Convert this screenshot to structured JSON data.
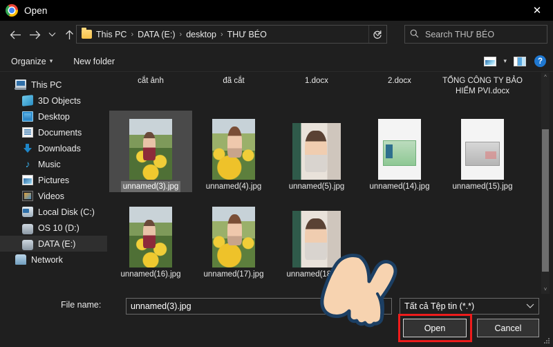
{
  "window": {
    "title": "Open",
    "app_icon": "chrome-logo-icon",
    "close_label": "✕"
  },
  "nav": {
    "back_icon": "arrow-left-icon",
    "forward_icon": "arrow-right-icon",
    "recent_icon": "chevron-down-icon",
    "up_icon": "arrow-up-icon"
  },
  "address": {
    "folder_icon": "folder-icon",
    "crumbs": [
      "This PC",
      "DATA (E:)",
      "desktop",
      "THƯ BÉO"
    ],
    "separator": "›",
    "dropdown_icon": "chevron-down-icon",
    "refresh_icon": "refresh-icon"
  },
  "search": {
    "icon": "search-icon",
    "placeholder": "Search THƯ BÉO",
    "value": ""
  },
  "command_bar": {
    "organize_label": "Organize",
    "organize_caret": "▾",
    "new_folder_label": "New folder",
    "view_icon": "view-options-icon",
    "view_caret": "▾",
    "pane_icon": "preview-pane-icon",
    "help_icon": "help-icon",
    "help_label": "?"
  },
  "sidebar": {
    "items": [
      {
        "label": "This PC",
        "icon": "this-pc-icon",
        "indent": 0,
        "selected": false
      },
      {
        "label": "3D Objects",
        "icon": "3d-objects-icon",
        "indent": 1,
        "selected": false
      },
      {
        "label": "Desktop",
        "icon": "desktop-icon",
        "indent": 1,
        "selected": false
      },
      {
        "label": "Documents",
        "icon": "documents-icon",
        "indent": 1,
        "selected": false
      },
      {
        "label": "Downloads",
        "icon": "downloads-icon",
        "indent": 1,
        "selected": false
      },
      {
        "label": "Music",
        "icon": "music-icon",
        "indent": 1,
        "selected": false
      },
      {
        "label": "Pictures",
        "icon": "pictures-icon",
        "indent": 1,
        "selected": false
      },
      {
        "label": "Videos",
        "icon": "videos-icon",
        "indent": 1,
        "selected": false
      },
      {
        "label": "Local Disk (C:)",
        "icon": "local-disk-icon",
        "indent": 1,
        "selected": false
      },
      {
        "label": "OS 10 (D:)",
        "icon": "drive-icon",
        "indent": 1,
        "selected": false
      },
      {
        "label": "DATA (E:)",
        "icon": "drive-icon",
        "indent": 1,
        "selected": true
      },
      {
        "label": "Network",
        "icon": "network-icon",
        "indent": 0,
        "selected": false
      }
    ],
    "scroll_up_icon": "chevron-up-icon",
    "scroll_down_icon": "chevron-down-icon"
  },
  "files": {
    "top_row_labels": [
      "cắt ảnh",
      "đã cắt",
      "1.docx",
      "2.docx",
      "TỔNG CÔNG TY BẢO HIỂM PVI.docx"
    ],
    "rows": [
      [
        {
          "name": "unnamed(3).jpg",
          "thumb": "sunflower-photo-1",
          "selected": true
        },
        {
          "name": "unnamed(4).jpg",
          "thumb": "sunflower-photo-2",
          "selected": false
        },
        {
          "name": "unnamed(5).jpg",
          "thumb": "cafe-portrait-photo",
          "selected": false
        },
        {
          "name": "unnamed(14).jpg",
          "thumb": "green-id-card-photo",
          "selected": false
        },
        {
          "name": "unnamed(15).jpg",
          "thumb": "grey-id-card-photo",
          "selected": false
        }
      ],
      [
        {
          "name": "unnamed(16).jpg",
          "thumb": "sunflower-photo-1",
          "selected": false
        },
        {
          "name": "unnamed(17).jpg",
          "thumb": "sunflower-photo-2",
          "selected": false
        },
        {
          "name": "unnamed(18).jpg",
          "thumb": "cafe-portrait-photo",
          "selected": false
        }
      ]
    ],
    "scroll_up_icon": "chevron-up-icon",
    "scroll_down_icon": "chevron-down-icon"
  },
  "footer": {
    "file_name_label": "File name:",
    "file_name_value": "unnamed(3).jpg",
    "file_type_value": "Tất cả Tệp tin (*.*)",
    "file_type_caret": "⌄",
    "open_label": "Open",
    "cancel_label": "Cancel"
  },
  "annotation": {
    "highlight_color": "#ee1c1c",
    "cursor": "pointing-hand-cursor"
  }
}
